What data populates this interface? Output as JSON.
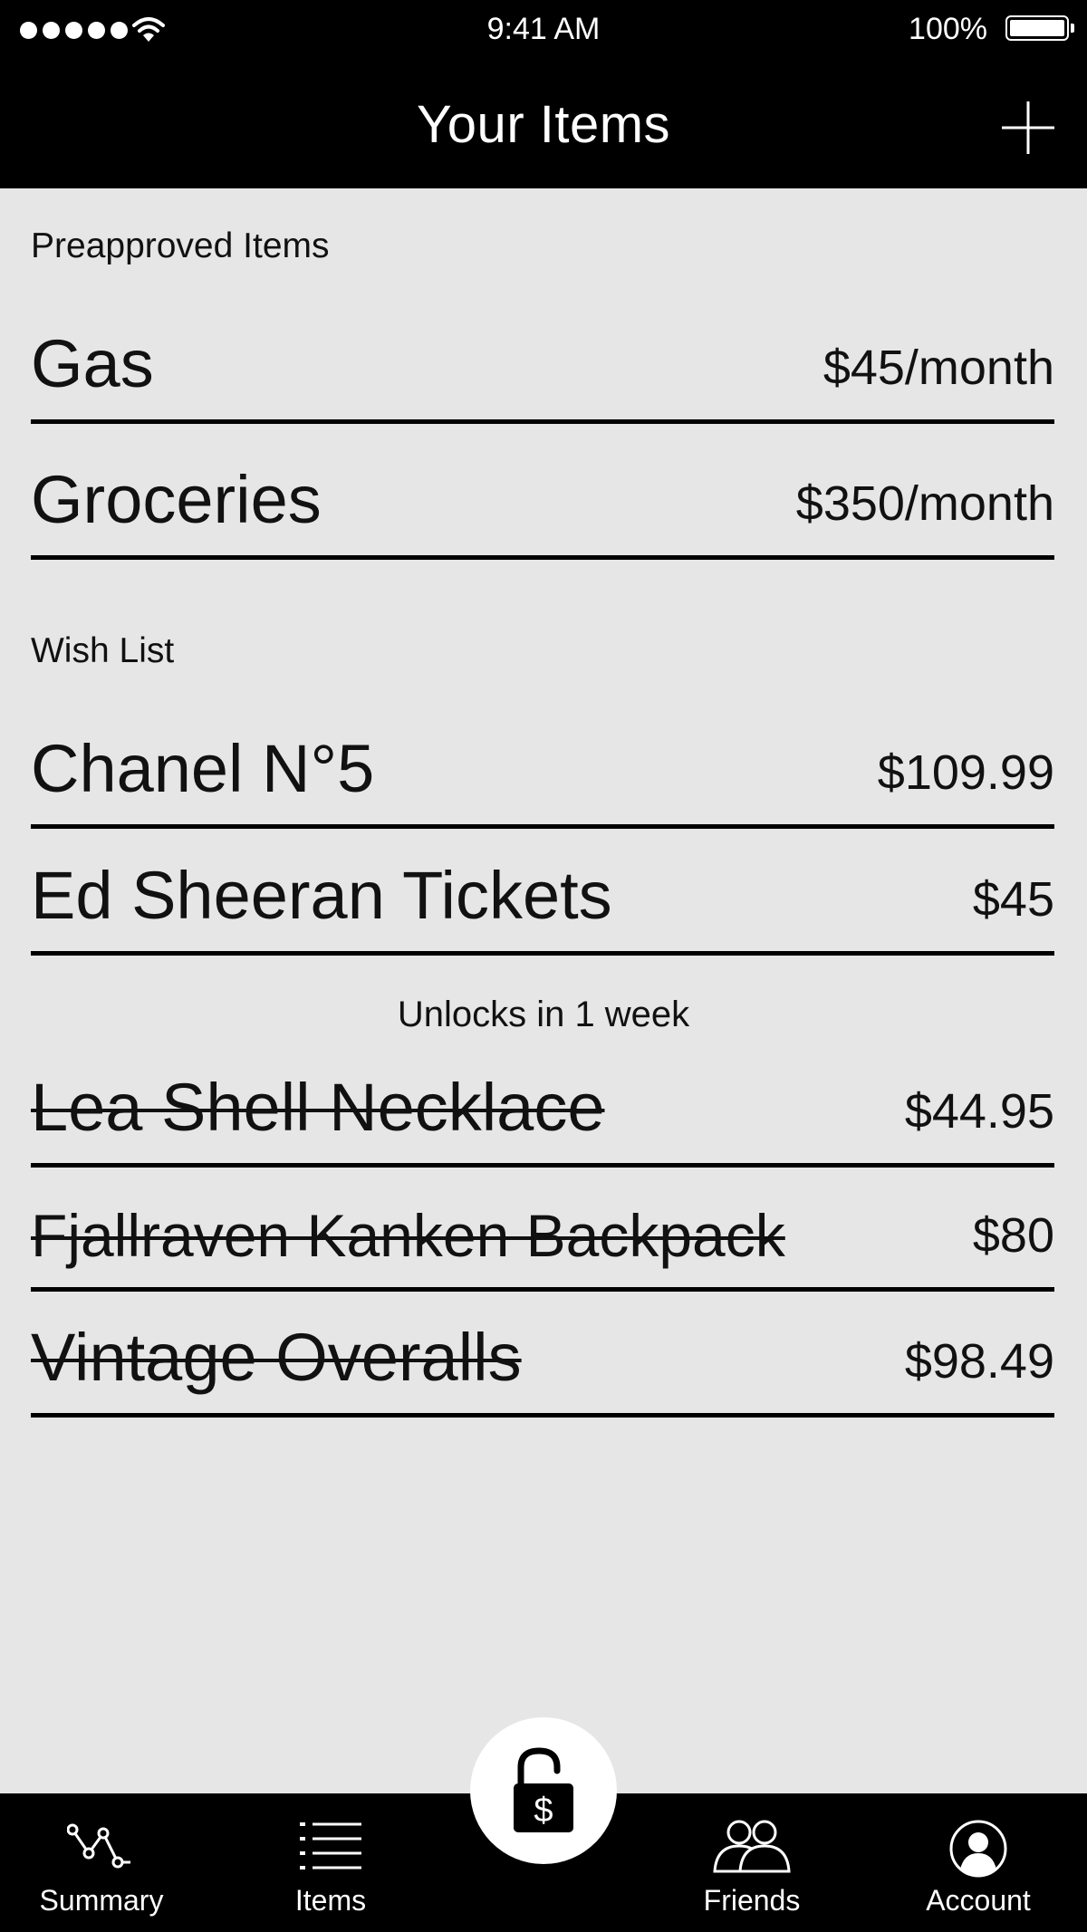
{
  "status_bar": {
    "time": "9:41 AM",
    "battery_percent": "100%",
    "battery_level": 1.0,
    "signal_bars": 5
  },
  "header": {
    "title": "Your Items",
    "add_icon": "plus-icon"
  },
  "preapproved": {
    "label": "Preapproved Items",
    "items": [
      {
        "name": "Gas",
        "price": "$45/month"
      },
      {
        "name": "Groceries",
        "price": "$350/month"
      }
    ]
  },
  "wishlist": {
    "label": "Wish List",
    "items": [
      {
        "name": "Chanel N°5",
        "price": "$109.99"
      },
      {
        "name": "Ed Sheeran Tickets",
        "price": "$45"
      }
    ],
    "unlock_note": "Unlocks in 1 week",
    "locked_items": [
      {
        "name": "Lea Shell Necklace",
        "price": "$44.95"
      },
      {
        "name": "Fjallraven Kanken Backpack",
        "price": "$80"
      },
      {
        "name": "Vintage Overalls",
        "price": "$98.49"
      }
    ]
  },
  "tab_bar": {
    "tabs": [
      {
        "label": "Summary",
        "icon": "chart-line-icon"
      },
      {
        "label": "Items",
        "icon": "list-icon"
      },
      {
        "label": "Friends",
        "icon": "friends-icon"
      },
      {
        "label": "Account",
        "icon": "account-icon"
      }
    ],
    "center_icon": "unlocked-padlock-dollar-icon"
  },
  "colors": {
    "bar_background": "#000000",
    "page_background": "#e6e6e6",
    "text": "#111111"
  }
}
